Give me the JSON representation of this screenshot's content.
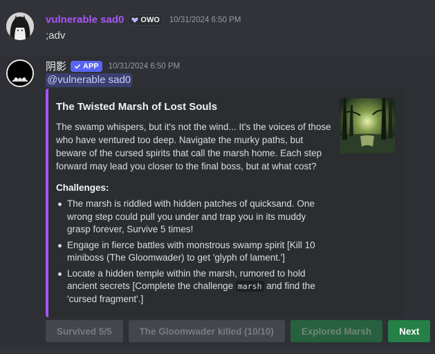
{
  "message1": {
    "username": "vulnerable sad0",
    "clan_tag": "OWO",
    "timestamp": "10/31/2024 6:50 PM",
    "content": ";adv"
  },
  "message2": {
    "username": "阴影",
    "app_badge": "APP",
    "timestamp": "10/31/2024 6:50 PM",
    "mention": "@vulnerable sad0",
    "embed": {
      "accent_color": "#a855f7",
      "title": "The Twisted Marsh of Lost Souls",
      "description": "The swamp whispers, but it's not the wind... It's the voices of those who have ventured too deep. Navigate the murky paths, but beware of the cursed spirits that call the marsh home. Each step forward may lead you closer to the final boss, but at what cost?",
      "challenges_heading": "Challenges:",
      "challenges": [
        {
          "text": "The marsh is riddled with hidden patches of quicksand. One wrong step could pull you under and trap you in its muddy grasp forever, Survive 5 times!"
        },
        {
          "text": "Engage in fierce battles with monstrous swamp spirit [Kill 10 miniboss (The Gloomwader) to get 'glyph of lament.']"
        },
        {
          "text_before": "Locate a hidden temple within the marsh, rumored to hold ancient secrets [Complete the challenge ",
          "code": "marsh",
          "text_after": " and find the 'cursed fragment'.]"
        }
      ]
    },
    "buttons": [
      {
        "label": "Survived 5/5"
      },
      {
        "label": "The Gloomwader killed (10/10)"
      },
      {
        "label": "Explored Marsh"
      },
      {
        "label": "Next"
      }
    ]
  },
  "colors": {
    "background": "#313338",
    "embed_bg": "#2b2d31",
    "username1": "#a855f7",
    "app_badge": "#5865f2",
    "success_button": "#248046",
    "secondary_button": "#4e5058"
  },
  "icons": {
    "clan_tag_icon": "heart-badge-icon",
    "app_badge_icon": "checkmark-icon"
  }
}
